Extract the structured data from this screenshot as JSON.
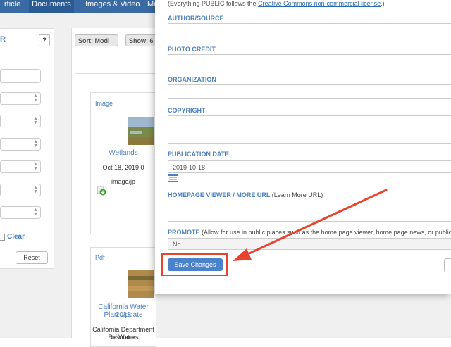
{
  "nav": {
    "tabs": [
      {
        "label": "rticle"
      },
      {
        "label": "Documents",
        "active": true
      },
      {
        "label": "Images & Video"
      },
      {
        "label": "Ma"
      }
    ]
  },
  "filter": {
    "title": "R",
    "help_label": "?",
    "clear_label": "Clear",
    "reset_label": "Reset"
  },
  "list": {
    "sort_label": "Sort: Modi",
    "show_label": "Show: 6",
    "cards": [
      {
        "type": "Image",
        "title": "Wetlands",
        "date": "Oct 18, 2019 0",
        "mime": "image/jp"
      },
      {
        "type": "Pdf",
        "title_line1": "California Water Plan Update",
        "title_line2": "2018",
        "org_line1": "California Department of Water",
        "org_line2": "Resources"
      }
    ]
  },
  "modal": {
    "cc_note_prefix": "(Everything PUBLIC follows the ",
    "cc_link": "Creative Commons non-commercial license",
    "cc_note_suffix": ".)",
    "author_label": "AUTHOR/SOURCE",
    "photo_credit_label": "PHOTO CREDIT",
    "organization_label": "ORGANIZATION",
    "copyright_label": "COPYRIGHT",
    "publication_date_label": "PUBLICATION DATE",
    "publication_date_value": "2019-10-18",
    "homepage_label": "HOMEPAGE VIEWER / MORE URL",
    "homepage_learn_more": "(Learn More URL)",
    "promote_label": "PROMOTE",
    "promote_note": "(Allow for use in public places such as the home page viewer, home page news, or public RS",
    "promote_value": "No",
    "save_label": "Save Changes"
  },
  "annotation": {
    "color": "#e8432f"
  }
}
